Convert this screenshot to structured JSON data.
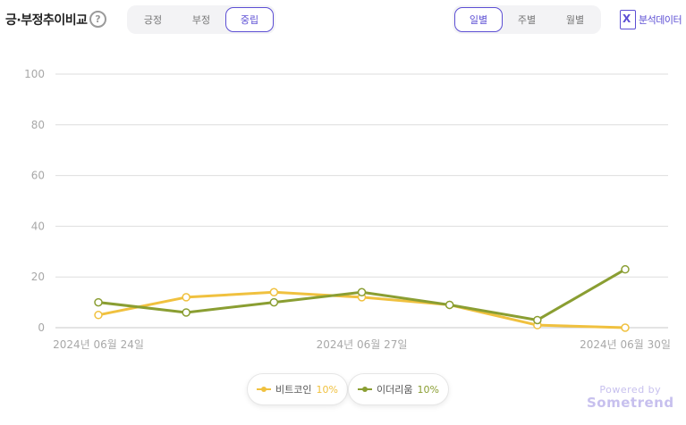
{
  "header": {
    "title": "긍·부정추이비교",
    "help_icon": "?",
    "sentiment_tabs": [
      "긍정",
      "부정",
      "중립"
    ],
    "sentiment_active": 2,
    "period_tabs": [
      "일별",
      "주별",
      "월별"
    ],
    "period_active": 0,
    "excel_label": "분석데이터",
    "excel_icon": "X"
  },
  "colors": {
    "bitcoin": "#f0c13f",
    "ethereum": "#8a9e32",
    "accent": "#5d4fd4",
    "grid": "#dedede"
  },
  "chart_data": {
    "type": "line",
    "x": [
      "2024-06-24",
      "2024-06-25",
      "2024-06-26",
      "2024-06-27",
      "2024-06-28",
      "2024-06-29",
      "2024-06-30"
    ],
    "x_tick_labels": [
      "2024년 06월 24일",
      "2024년 06월 27일",
      "2024년 06월 30일"
    ],
    "y_ticks": [
      0,
      20,
      40,
      60,
      80,
      100
    ],
    "ylim": [
      0,
      100
    ],
    "grid": true,
    "legend_position": "bottom-center",
    "series": [
      {
        "name": "비트코인",
        "pct": "10%",
        "color": "#f0c13f",
        "values": [
          5,
          12,
          14,
          12,
          9,
          1,
          0
        ]
      },
      {
        "name": "이더리움",
        "pct": "10%",
        "color": "#8a9e32",
        "values": [
          10,
          6,
          10,
          14,
          9,
          3,
          23
        ]
      }
    ]
  },
  "footer": {
    "powered_line1": "Powered by",
    "powered_line2": "Sometrend"
  }
}
